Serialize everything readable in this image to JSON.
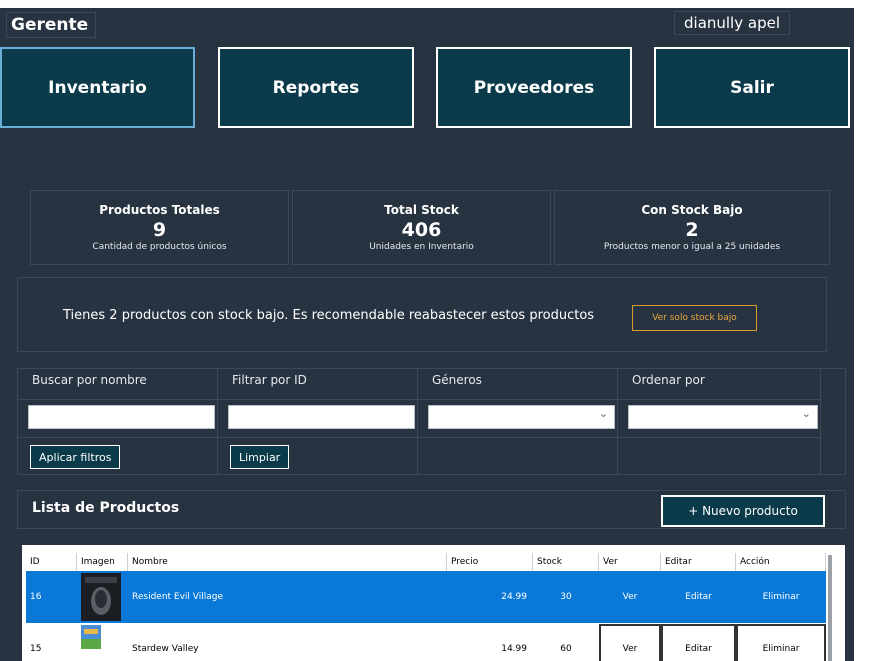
{
  "header": {
    "role": "Gerente",
    "user": "dianully apel"
  },
  "nav": [
    {
      "label": "Inventario"
    },
    {
      "label": "Reportes"
    },
    {
      "label": "Proveedores"
    },
    {
      "label": "Salir"
    }
  ],
  "stats": [
    {
      "title": "Productos Totales",
      "value": "9",
      "subtitle": "Cantidad de productos únicos"
    },
    {
      "title": "Total Stock",
      "value": "406",
      "subtitle": "Unidades en Inventario"
    },
    {
      "title": "Con Stock Bajo",
      "value": "2",
      "subtitle": "Productos menor o igual a 25 unidades"
    }
  ],
  "alert": {
    "message": "Tienes 2 productos con stock bajo. Es recomendable reabastecer estos productos",
    "button": "Ver solo stock bajo",
    "accent": "#d89b2b"
  },
  "filters": {
    "name_label": "Buscar por nombre",
    "id_label": "Filtrar por ID",
    "genre_label": "Géneros",
    "sort_label": "Ordenar por",
    "name_value": "",
    "id_value": "",
    "genre_value": "",
    "sort_value": "",
    "apply_button": "Aplicar filtros",
    "clear_button": "Limpiar"
  },
  "list": {
    "title": "Lista de Productos",
    "new_button": "+ Nuevo producto"
  },
  "table": {
    "columns": [
      "ID",
      "Imagen",
      "Nombre",
      "Precio",
      "Stock",
      "Ver",
      "Editar",
      "Acción"
    ],
    "rows": [
      {
        "id": "16",
        "name": "Resident Evil Village",
        "price": "24.99",
        "stock": "30",
        "view": "Ver",
        "edit": "Editar",
        "action": "Eliminar",
        "selected": true
      },
      {
        "id": "15",
        "name": "Stardew Valley",
        "price": "14.99",
        "stock": "60",
        "view": "Ver",
        "edit": "Editar",
        "action": "Eliminar",
        "selected": false
      }
    ],
    "selected_color": "#0a78d7"
  },
  "colors": {
    "background": "#283341",
    "button": "#0b3b4a"
  }
}
